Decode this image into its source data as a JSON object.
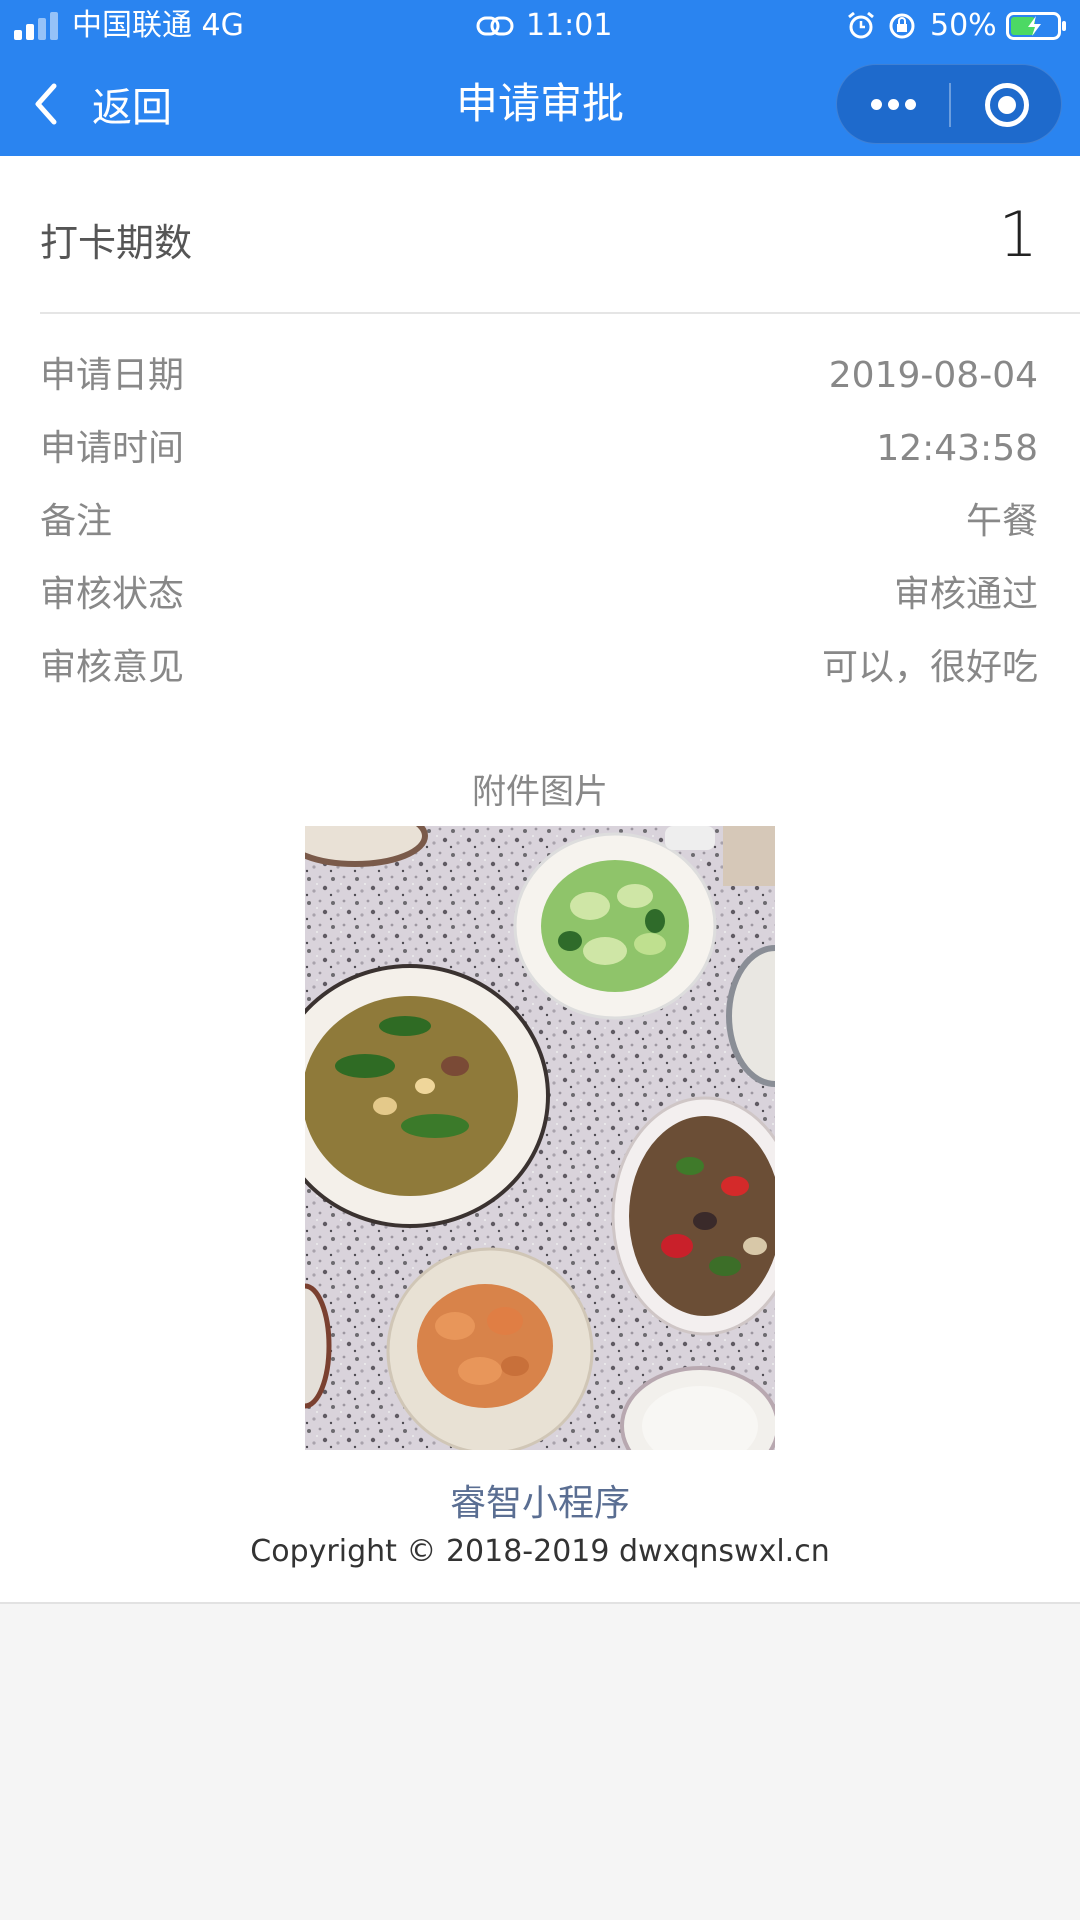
{
  "status_bar": {
    "carrier": "中国联通 4G",
    "time": "11:01",
    "battery": "50%"
  },
  "nav": {
    "back_label": "返回",
    "title": "申请审批"
  },
  "period": {
    "label": "打卡期数",
    "value": "1"
  },
  "details": [
    {
      "label": "申请日期",
      "value": "2019-08-04"
    },
    {
      "label": "申请时间",
      "value": "12:43:58"
    },
    {
      "label": "备注",
      "value": "午餐"
    },
    {
      "label": "审核状态",
      "value": "审核通过"
    },
    {
      "label": "审核意见",
      "value": "可以，很好吃"
    }
  ],
  "attachment": {
    "title": "附件图片"
  },
  "footer": {
    "brand": "睿智小程序",
    "copyright": "Copyright © 2018-2019 dwxqnswxl.cn"
  },
  "colors": {
    "accent": "#2a84f0",
    "muted_text": "#888888",
    "brand_link": "#5a6e92"
  }
}
